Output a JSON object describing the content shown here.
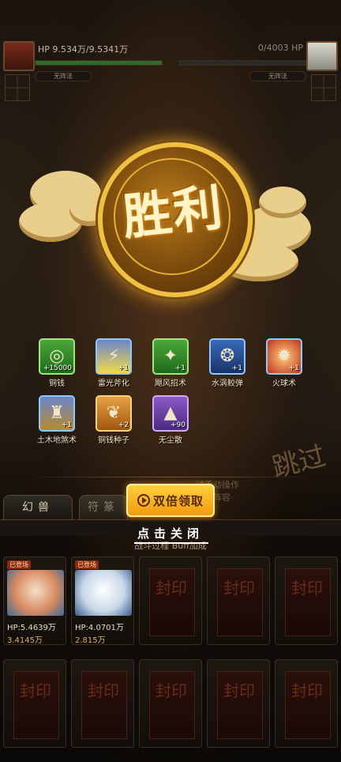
{
  "hud": {
    "player_hp": "HP 9.534万/9.5341万",
    "enemy_hp": "0/4003 HP",
    "player_status": "无阵法",
    "enemy_status": "无阵法"
  },
  "result": {
    "title": "胜利"
  },
  "rewards": [
    {
      "name": "铜钱",
      "qty": "+15000",
      "icon": "copper-coin-icon",
      "rarity": "green",
      "glyph": "◎"
    },
    {
      "name": "雷光斧化",
      "qty": "+1",
      "icon": "lightning-axe-icon",
      "rarity": "blue",
      "glyph": "⚡"
    },
    {
      "name": "飓风招术",
      "qty": "+1",
      "icon": "whirlwind-icon",
      "rarity": "green",
      "glyph": "✦"
    },
    {
      "name": "水涡鲛弹",
      "qty": "+1",
      "icon": "water-vortex-icon",
      "rarity": "blue",
      "glyph": "❂"
    },
    {
      "name": "火球术",
      "qty": "+1",
      "icon": "fireball-icon",
      "rarity": "blue",
      "glyph": "✹"
    },
    {
      "name": "土木地煞术",
      "qty": "+1",
      "icon": "earth-dragon-icon",
      "rarity": "blue",
      "glyph": "♜"
    },
    {
      "name": "铜钱种子",
      "qty": "+2",
      "icon": "seed-sprout-icon",
      "rarity": "orange",
      "glyph": "❦"
    },
    {
      "name": "无尘散",
      "qty": "+90",
      "icon": "dust-powder-icon",
      "rarity": "purple",
      "glyph": "▲"
    }
  ],
  "buttons": {
    "double_claim": "双倍领取",
    "skip": "跳过"
  },
  "hint_text": [
    "试手动操作",
    "关，阵容·"
  ],
  "tabs": [
    "幻兽",
    "符篆"
  ],
  "close_hint": "点击关闭",
  "battle_info": "战斗过程                        Buff加成",
  "pets": [
    {
      "tag": "已登场",
      "hp": "HP:5.4639万",
      "power": "3.4145万"
    },
    {
      "tag": "已登场",
      "hp": "HP:4.0701万",
      "power": "2.815万"
    }
  ],
  "sealed_label": "封印",
  "colors": {
    "accent": "#f3a818",
    "victory_gold": "#f0c040",
    "panel": "#120e0a"
  }
}
